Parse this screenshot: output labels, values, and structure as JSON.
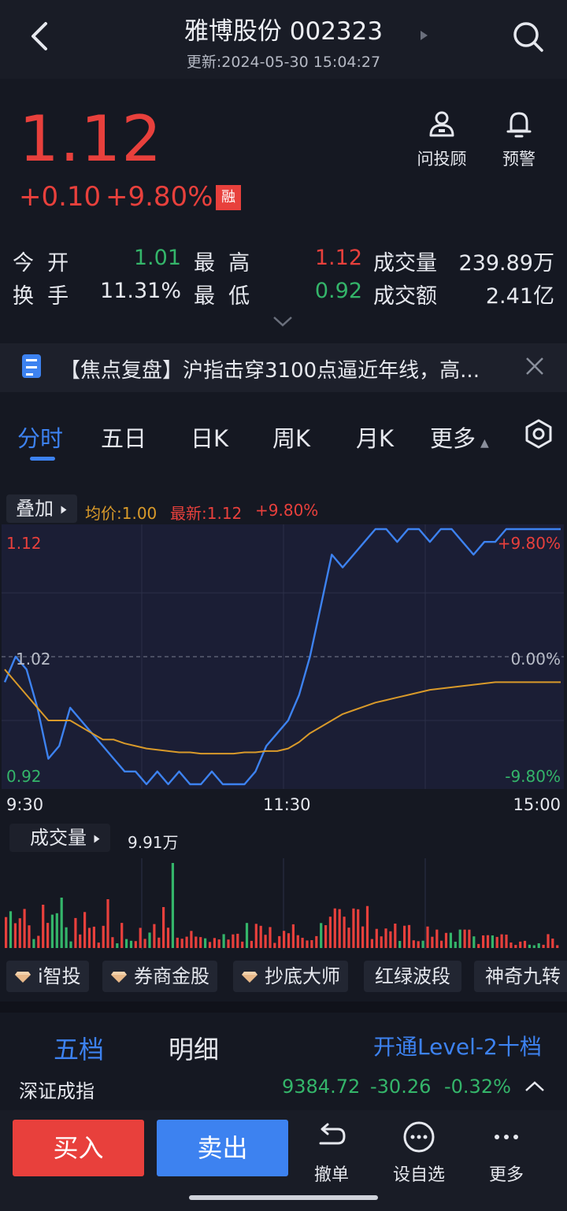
{
  "header": {
    "title": "雅博股份 002323",
    "updated": "更新:2024-05-30 15:04:27"
  },
  "quote": {
    "price": "1.12",
    "change": "+0.10",
    "change_pct": "+9.80%",
    "margin_badge": "融",
    "actions": [
      {
        "label": "问投顾",
        "icon": "advisor-icon"
      },
      {
        "label": "预警",
        "icon": "bell-icon"
      }
    ]
  },
  "stats": {
    "open_label": "今  开",
    "open": "1.01",
    "high_label": "最  高",
    "high": "1.12",
    "volume_label": "成交量",
    "volume": "239.89万",
    "turnover_label": "换  手",
    "turnover": "11.31%",
    "low_label": "最  低",
    "low": "0.92",
    "amount_label": "成交额",
    "amount": "2.41亿"
  },
  "news": {
    "text": "【焦点复盘】沪指击穿3100点逼近年线，高..."
  },
  "tabs": [
    "分时",
    "五日",
    "日K",
    "周K",
    "月K",
    "更多"
  ],
  "chart_toolbar": {
    "overlay": "叠加",
    "avg": "均价:1.00",
    "latest": "最新:1.12",
    "pct": "+9.80%"
  },
  "chart_data": {
    "type": "line",
    "ylim": [
      0.92,
      1.12
    ],
    "y_labels_left": [
      "1.12",
      "1.02",
      "0.92"
    ],
    "y_labels_right": [
      "+9.80%",
      "0.00%",
      "-9.80%"
    ],
    "x_labels": [
      "9:30",
      "11:30",
      "15:00"
    ],
    "series": [
      {
        "color": "#3d82f0",
        "values": [
          1.0,
          1.02,
          1.01,
          0.98,
          0.94,
          0.95,
          0.98,
          0.97,
          0.96,
          0.95,
          0.94,
          0.93,
          0.93,
          0.92,
          0.93,
          0.92,
          0.93,
          0.92,
          0.92,
          0.93,
          0.92,
          0.92,
          0.92,
          0.93,
          0.95,
          0.96,
          0.97,
          0.99,
          1.02,
          1.06,
          1.1,
          1.09,
          1.1,
          1.11,
          1.12,
          1.12,
          1.11,
          1.12,
          1.12,
          1.11,
          1.12,
          1.12,
          1.11,
          1.1,
          1.11,
          1.11,
          1.12,
          1.12,
          1.12,
          1.12,
          1.12,
          1.12
        ]
      },
      {
        "color": "#d99a2a",
        "values": [
          1.01,
          1.0,
          0.99,
          0.98,
          0.97,
          0.97,
          0.97,
          0.965,
          0.96,
          0.955,
          0.955,
          0.952,
          0.95,
          0.948,
          0.947,
          0.946,
          0.945,
          0.945,
          0.944,
          0.944,
          0.944,
          0.944,
          0.945,
          0.945,
          0.946,
          0.946,
          0.948,
          0.953,
          0.96,
          0.965,
          0.97,
          0.975,
          0.978,
          0.981,
          0.984,
          0.986,
          0.988,
          0.99,
          0.992,
          0.994,
          0.995,
          0.996,
          0.997,
          0.998,
          0.999,
          1.0,
          1.0,
          1.0,
          1.0,
          1.0,
          1.0,
          1.0
        ]
      }
    ]
  },
  "volume": {
    "label": "成交量",
    "value": "9.91万"
  },
  "indicators": [
    {
      "label": "i智投",
      "gem": true
    },
    {
      "label": "券商金股",
      "gem": true
    },
    {
      "label": "抄底大师",
      "gem": true
    },
    {
      "label": "红绿波段",
      "gem": false
    },
    {
      "label": "神奇九转",
      "gem": false
    }
  ],
  "orderbook": {
    "tab1": "五档",
    "tab2": "明细",
    "link": "开通Level-2十档"
  },
  "index": {
    "name": "深证成指",
    "value": "9384.72",
    "change": "-30.26",
    "pct": "-0.32%"
  },
  "bottom": {
    "buy": "买入",
    "sell": "卖出",
    "actions": [
      {
        "label": "撤单",
        "icon": "undo-icon"
      },
      {
        "label": "设自选",
        "icon": "more-circle-icon"
      },
      {
        "label": "更多",
        "icon": "dots-icon"
      }
    ]
  }
}
